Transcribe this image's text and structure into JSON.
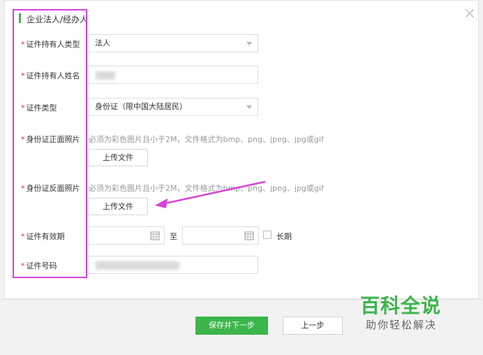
{
  "dialog": {
    "close_icon": "close-icon"
  },
  "section": {
    "title": "企业法人/经办人"
  },
  "required_mark": "*",
  "form": {
    "holder_type": {
      "label": "证件持有人类型",
      "value": "法人"
    },
    "holder_name": {
      "label": "证件持有人姓名",
      "value": ""
    },
    "cert_type": {
      "label": "证件类型",
      "value": "身份证（限中国大陆居民）"
    },
    "front_photo": {
      "label": "身份证正面照片",
      "hint": "必须为彩色图片且小于2M，文件格式为bmp、png、jpeg、jpg或gif",
      "button": "上传文件"
    },
    "back_photo": {
      "label": "身份证反面照片",
      "hint": "必须为彩色图片且小于2M，文件格式为bmp、png、jpeg、jpg或gif",
      "button": "上传文件"
    },
    "validity": {
      "label": "证件有效期",
      "start": "",
      "separator": "至",
      "end": "",
      "long_term_label": "长期",
      "long_term_checked": false
    },
    "cert_number": {
      "label": "证件号码",
      "value": ""
    }
  },
  "footer": {
    "save_next": "保存并下一步",
    "prev": "上一步"
  },
  "watermark": {
    "title": "百科全说",
    "subtitle": "助你轻松解决"
  },
  "colors": {
    "accent": "#3cb54a",
    "highlight": "#d940d9",
    "required": "#e0302f"
  }
}
